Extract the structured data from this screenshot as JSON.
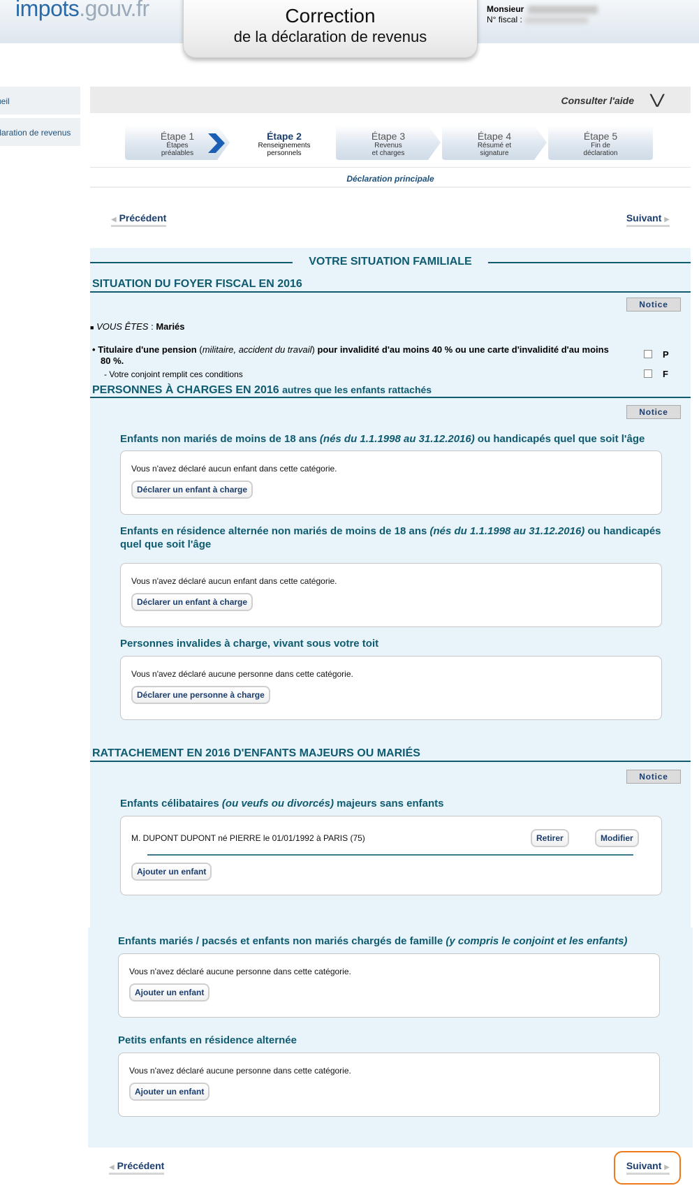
{
  "header": {
    "logo_main": "impots",
    "logo_dim": ".gouv.fr",
    "title_line1": "Correction",
    "title_line2": "de la déclaration de revenus",
    "ident_label1": "Monsieur",
    "ident_label2": "N° fiscal :"
  },
  "leftnav": {
    "items": [
      {
        "label": "Accueil"
      },
      {
        "label": "Déclaration de revenus"
      }
    ]
  },
  "help": {
    "label": "Consulter l'aide",
    "icon": "double-chevron-down-icon"
  },
  "steps": [
    {
      "title": "Étape 1",
      "subtitle": "Étapes préalables",
      "sub1": "Étapes",
      "sub2": "préalables",
      "active": false
    },
    {
      "title": "Étape 2",
      "subtitle": "Renseignements personnels",
      "sub1": "Renseignements",
      "sub2": "personnels",
      "active": true
    },
    {
      "title": "Étape 3",
      "subtitle": "Revenus et charges",
      "sub1": "Revenus",
      "sub2": "et charges",
      "active": false
    },
    {
      "title": "Étape 4",
      "subtitle": "Résumé et signature",
      "sub1": "Résumé et",
      "sub2": "signature",
      "active": false
    },
    {
      "title": "Étape 5",
      "subtitle": "Fin de déclaration",
      "sub1": "Fin de",
      "sub2": "déclaration",
      "active": false
    }
  ],
  "declaration_label": "Déclaration principale",
  "nav": {
    "prev": "Précédent",
    "next": "Suivant"
  },
  "section_title": "VOTRE SITUATION FAMILIALE",
  "foyer": {
    "heading": "SITUATION DU FOYER FISCAL EN 2016",
    "notice": "Notice",
    "vous_etes_label": "VOUS ÊTES",
    "vous_etes_value": "Mariés",
    "pension_bold1": "Titulaire d'une pension",
    "pension_italic": "militaire, accident du travail",
    "pension_bold2": "pour invalidité d'au moins 40 % ou une carte d'invalidité d'au moins",
    "pension_bold3": "80 %.",
    "conjoint_text": "- Votre conjoint remplit ces conditions",
    "letter_p": "P",
    "letter_f": "F"
  },
  "charges": {
    "heading_bold": "PERSONNES À CHARGES EN 2016",
    "heading_small": "autres que les enfants rattachés",
    "notice": "Notice",
    "categories": [
      {
        "title_a": "Enfants non mariés de moins de 18 ans ",
        "title_b": "(nés du 1.1.1998 au 31.12.2016)",
        "title_c": " ou handicapés quel que soit l'âge",
        "message": "Vous n'avez déclaré aucun enfant dans cette catégorie.",
        "button": "Déclarer un enfant à charge"
      },
      {
        "title_a": "Enfants en résidence alternée non mariés de moins de 18 ans ",
        "title_b": "(nés du 1.1.1998 au 31.12.2016)",
        "title_c": " ou handicapés",
        "title_d": "quel que soit l'âge",
        "message": "Vous n'avez déclaré aucun enfant dans cette catégorie.",
        "button": "Déclarer un enfant à charge"
      },
      {
        "title_a": "Personnes invalides à charge, vivant sous votre toit",
        "message": "Vous n'avez déclaré aucune personne dans cette catégorie.",
        "button": "Déclarer une personne à charge"
      }
    ]
  },
  "rattachement": {
    "heading": "RATTACHEMENT EN 2016 D'ENFANTS MAJEURS OU MARIÉS",
    "notice": "Notice",
    "categories": [
      {
        "title_a": "Enfants célibataires ",
        "title_b": "(ou veufs ou divorcés)",
        "title_c": " majeurs sans enfants",
        "person": "M. DUPONT DUPONT né PIERRE le 01/01/1992 à PARIS (75)",
        "retirer": "Retirer",
        "modifier": "Modifier",
        "button": "Ajouter un enfant"
      },
      {
        "title_a": "Enfants mariés / pacsés et enfants non mariés chargés de famille ",
        "title_b": "(y compris le conjoint et les enfants)",
        "message": "Vous n'avez déclaré aucune personne dans cette catégorie.",
        "button": "Ajouter un enfant"
      },
      {
        "title_a": "Petits enfants en résidence alternée",
        "message": "Vous n'avez déclaré aucune personne dans cette catégorie.",
        "button": "Ajouter un enfant"
      }
    ]
  },
  "colors": {
    "accent": "#0f5b70",
    "panel_bg": "#e8f3fa",
    "link": "#1b3e6e",
    "highlight": "#ee7a1a"
  }
}
